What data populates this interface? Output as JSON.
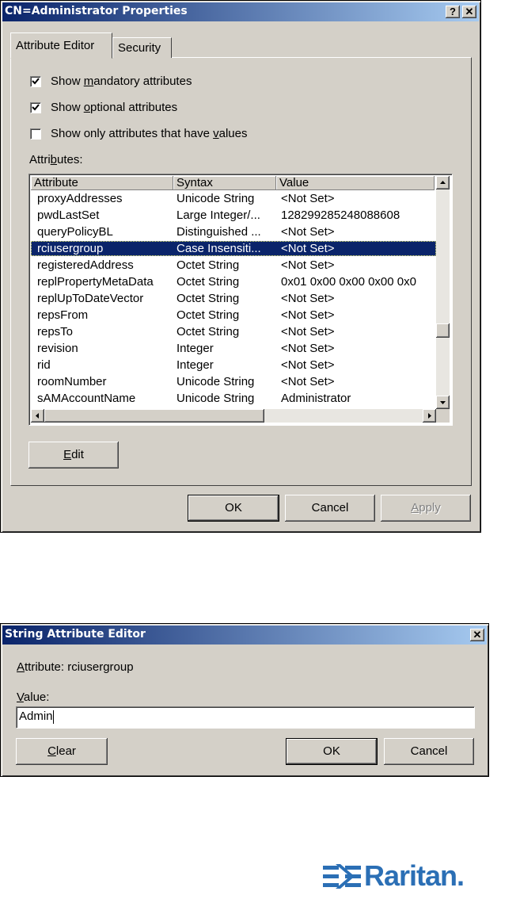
{
  "properties_window": {
    "title": "CN=Administrator Properties",
    "help_glyph": "?",
    "close_glyph": "✕",
    "tabs": [
      {
        "label": "Attribute Editor"
      },
      {
        "label": "Security"
      }
    ],
    "options": [
      {
        "prefix": "Show ",
        "accel": "m",
        "suffix": "andatory attributes",
        "checked": true
      },
      {
        "prefix": "Show ",
        "accel": "o",
        "suffix": "ptional attributes",
        "checked": true
      },
      {
        "prefix": "Show only attributes that have ",
        "accel": "v",
        "suffix": "alues",
        "checked": false
      }
    ],
    "attributes_label_prefix": "Attri",
    "attributes_label_accel": "b",
    "attributes_label_suffix": "utes:",
    "columns": [
      "Attribute",
      "Syntax",
      "Value"
    ],
    "rows": [
      {
        "attribute": "proxyAddresses",
        "syntax": "Unicode String",
        "value": "<Not Set>"
      },
      {
        "attribute": "pwdLastSet",
        "syntax": "Large Integer/...",
        "value": "128299285248088608"
      },
      {
        "attribute": "queryPolicyBL",
        "syntax": "Distinguished ...",
        "value": "<Not Set>"
      },
      {
        "attribute": "rciusergroup",
        "syntax": "Case Insensiti...",
        "value": "<Not Set>",
        "selected": true
      },
      {
        "attribute": "registeredAddress",
        "syntax": "Octet String",
        "value": "<Not Set>"
      },
      {
        "attribute": "replPropertyMetaData",
        "syntax": "Octet String",
        "value": "0x01 0x00 0x00 0x00 0x0"
      },
      {
        "attribute": "replUpToDateVector",
        "syntax": "Octet String",
        "value": "<Not Set>"
      },
      {
        "attribute": "repsFrom",
        "syntax": "Octet String",
        "value": "<Not Set>"
      },
      {
        "attribute": "repsTo",
        "syntax": "Octet String",
        "value": "<Not Set>"
      },
      {
        "attribute": "revision",
        "syntax": "Integer",
        "value": "<Not Set>"
      },
      {
        "attribute": "rid",
        "syntax": "Integer",
        "value": "<Not Set>"
      },
      {
        "attribute": "roomNumber",
        "syntax": "Unicode String",
        "value": "<Not Set>"
      },
      {
        "attribute": "sAMAccountName",
        "syntax": "Unicode String",
        "value": "Administrator"
      }
    ],
    "edit_button": {
      "accel": "E",
      "rest": "dit"
    },
    "ok_label": "OK",
    "cancel_label": "Cancel",
    "apply_button": {
      "accel": "A",
      "rest": "pply",
      "disabled": true
    }
  },
  "string_editor": {
    "title": "String Attribute Editor",
    "close_glyph": "✕",
    "attribute_label": {
      "accel": "A",
      "rest": "ttribute: rciusergroup"
    },
    "value_label": {
      "accel": "V",
      "rest": "alue:"
    },
    "value_input": "Admin",
    "clear_button": {
      "accel": "C",
      "rest": "lear"
    },
    "ok_label": "OK",
    "cancel_label": "Cancel"
  },
  "logo": {
    "text": "Raritan.",
    "color": "#2b6fb5"
  }
}
